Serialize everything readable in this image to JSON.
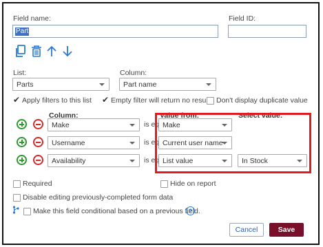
{
  "field_name_label": "Field name:",
  "field_name_value": "Part",
  "field_id_label": "Field ID:",
  "field_id_value": "",
  "toolbar": {
    "icons": [
      "copy-icon",
      "trash-icon",
      "arrow-up-icon",
      "arrow-down-icon"
    ]
  },
  "list_label": "List:",
  "list_value": "Parts",
  "column_label": "Column:",
  "column_value": "Part name",
  "options": {
    "apply_filters": "Apply filters to this list",
    "empty_filter": "Empty filter will return no results",
    "no_duplicates": "Don't display duplicate value"
  },
  "filter_headers": {
    "column": "Column:",
    "value_from": "Value from:",
    "select_value": "Select value:"
  },
  "filters": [
    {
      "column": "Make",
      "operator": "is equal to",
      "value_from": "Make",
      "select_value": ""
    },
    {
      "column": "Username",
      "operator": "is equal to",
      "value_from": "Current user name",
      "select_value": ""
    },
    {
      "column": "Availability",
      "operator": "is equal to",
      "value_from": "List value",
      "select_value": "In Stock"
    }
  ],
  "required_label": "Required",
  "hide_on_report_label": "Hide on report",
  "disable_editing_label": "Disable editing previously-completed form data",
  "conditional_label": "Make this field conditional based on a previous field.",
  "help_label": "?",
  "cancel_label": "Cancel",
  "save_label": "Save",
  "colors": {
    "accent": "#2a7ad4",
    "save": "#7a0f2b",
    "highlight": "#e11b22",
    "add": "#2a9a2a",
    "remove": "#d62828"
  }
}
